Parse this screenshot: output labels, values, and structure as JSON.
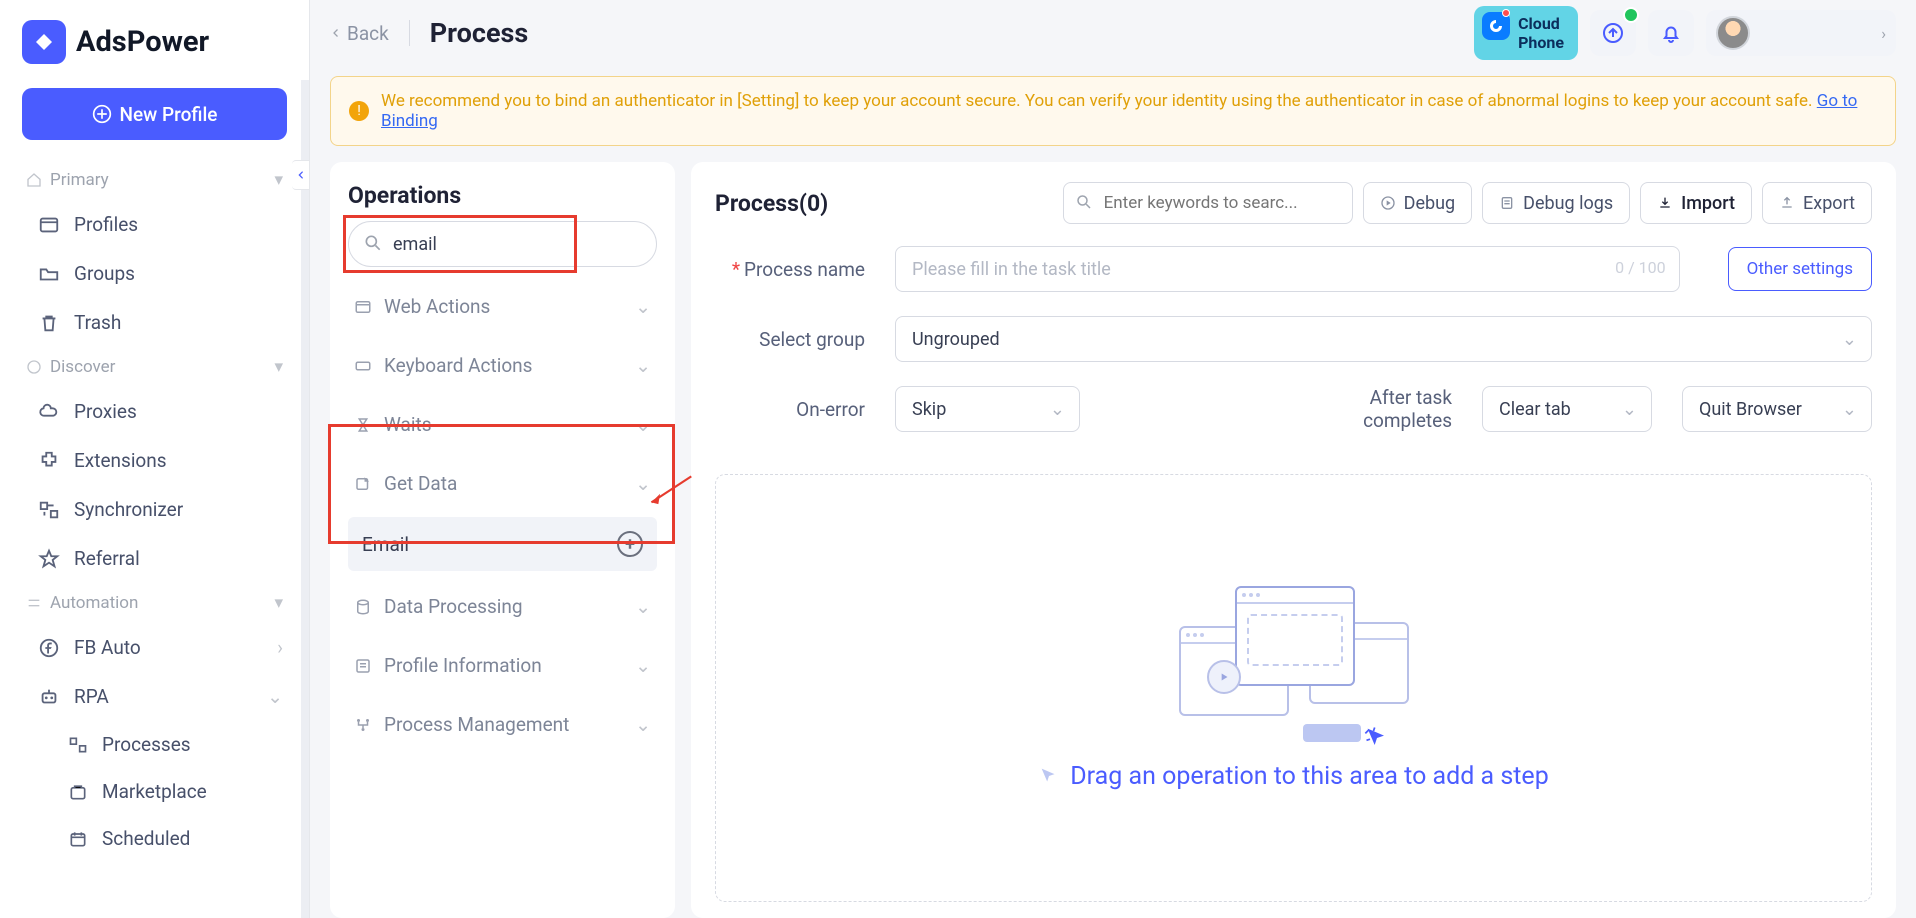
{
  "brand": {
    "name": "AdsPower"
  },
  "sidebar": {
    "new_profile": "New Profile",
    "sections": {
      "primary": {
        "label": "Primary",
        "items": [
          "Profiles",
          "Groups",
          "Trash"
        ]
      },
      "discover": {
        "label": "Discover",
        "items": [
          "Proxies",
          "Extensions",
          "Synchronizer",
          "Referral"
        ]
      },
      "automation": {
        "label": "Automation",
        "items": [
          "FB Auto",
          "RPA"
        ],
        "rpa_children": [
          "Processes",
          "Marketplace",
          "Scheduled"
        ]
      }
    }
  },
  "header": {
    "back": "Back",
    "title": "Process",
    "cloud_phone": "Cloud\nPhone"
  },
  "banner": {
    "text": "We recommend you to bind an authenticator in [Setting] to keep your account secure. You can verify your identity using the authenticator in case of abnormal logins to keep your account safe. ",
    "link": "Go to Binding"
  },
  "operations": {
    "title": "Operations",
    "search_value": "email",
    "groups": [
      "Web Actions",
      "Keyboard Actions",
      "Waits",
      "Get Data",
      "Data Processing",
      "Profile Information",
      "Process Management"
    ],
    "get_data_item": "Email"
  },
  "process": {
    "title": "Process(0)",
    "search_placeholder": "Enter keywords to searc...",
    "buttons": {
      "debug": "Debug",
      "debug_logs": "Debug logs",
      "import": "Import",
      "export": "Export"
    },
    "form": {
      "name_label": "Process name",
      "name_placeholder": "Please fill in the task title",
      "name_count": "0 / 100",
      "other_settings": "Other settings",
      "group_label": "Select group",
      "group_value": "Ungrouped",
      "onerror_label": "On-error",
      "onerror_value": "Skip",
      "after_label": "After task\ncompletes",
      "after_value1": "Clear tab",
      "after_value2": "Quit Browser"
    },
    "dropzone_text": "Drag an operation to this area to add a step"
  }
}
